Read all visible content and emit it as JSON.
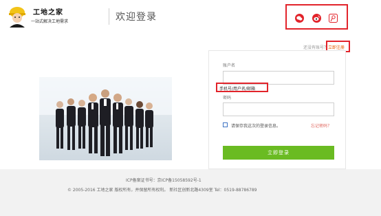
{
  "header": {
    "logo_name": "工地之家",
    "logo_tagline": "一站式解决工地需求",
    "welcome": "欢迎登录"
  },
  "social": {
    "icons": [
      "wechat-icon",
      "weibo-icon",
      "tencent-weibo-icon"
    ]
  },
  "register": {
    "prompt": "还没有账号？",
    "link": "立即注册"
  },
  "login": {
    "username_label": "账户名",
    "username_value": "",
    "username_hint": "手机号/用户名/邮箱",
    "password_label": "密码",
    "password_value": "",
    "remember_label": "请保存我这次的登录信息。",
    "forgot_link": "忘记密码？",
    "submit": "立即登录"
  },
  "footer": {
    "icp": "ICP备案证书号：京ICP备15058592号-1",
    "copyright": "© 2005-2016 工地之家 版权所有，并保留所有权利。  新社区创新北路4309室  Tel：0519-88786789"
  },
  "colors": {
    "accent_green": "#6abb22",
    "highlight_red": "#e2232a",
    "link_orange": "#e85c00"
  }
}
